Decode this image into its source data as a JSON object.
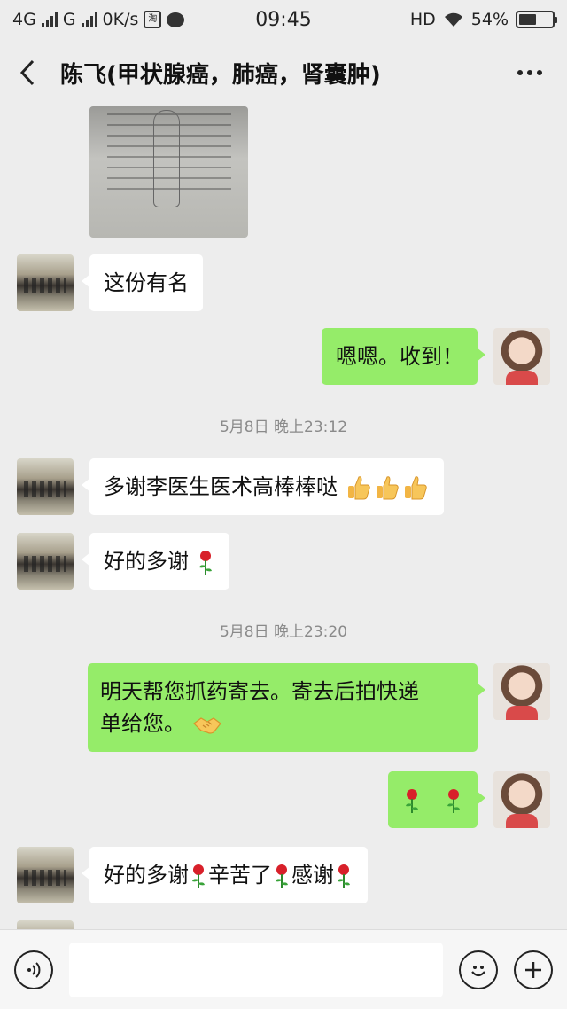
{
  "status_bar": {
    "network1": "4G",
    "network2": "G",
    "speed": "0K/s",
    "taobao_badge": "淘",
    "time": "09:45",
    "hd": "HD",
    "battery_text": "54%",
    "battery_level": 0.54
  },
  "header": {
    "title": "陈飞(甲状腺癌，肺癌，肾囊肿)"
  },
  "messages": [
    {
      "side": "left",
      "text": "这份有名"
    },
    {
      "side": "right",
      "text": "嗯嗯。收到！"
    },
    {
      "timestamp": "5月8日 晚上23:12"
    },
    {
      "side": "left",
      "text": "多谢李医生医术高棒棒哒",
      "emoji": [
        "thumbs-up-icon",
        "thumbs-up-icon",
        "thumbs-up-icon"
      ]
    },
    {
      "side": "left",
      "text": "好的多谢",
      "emoji": [
        "rose-icon"
      ]
    },
    {
      "timestamp": "5月8日 晚上23:20"
    },
    {
      "side": "right",
      "line1": "明天帮您抓药寄去。寄去后拍快递",
      "line2": "单给您。",
      "emoji": [
        "handshake-icon"
      ]
    },
    {
      "side": "right",
      "text": "",
      "emoji": [
        "rose-icon",
        "rose-icon"
      ]
    },
    {
      "side": "left",
      "parts": [
        "好的多谢",
        "辛苦了",
        "感谢"
      ],
      "emoji": [
        "rose-icon",
        "rose-icon",
        "rose-icon"
      ]
    }
  ],
  "input_bar": {
    "placeholder": ""
  },
  "colors": {
    "background": "#ededed",
    "bubble_sent": "#95ec69",
    "bubble_received": "#ffffff",
    "timestamp_text": "#8a8a8a"
  }
}
